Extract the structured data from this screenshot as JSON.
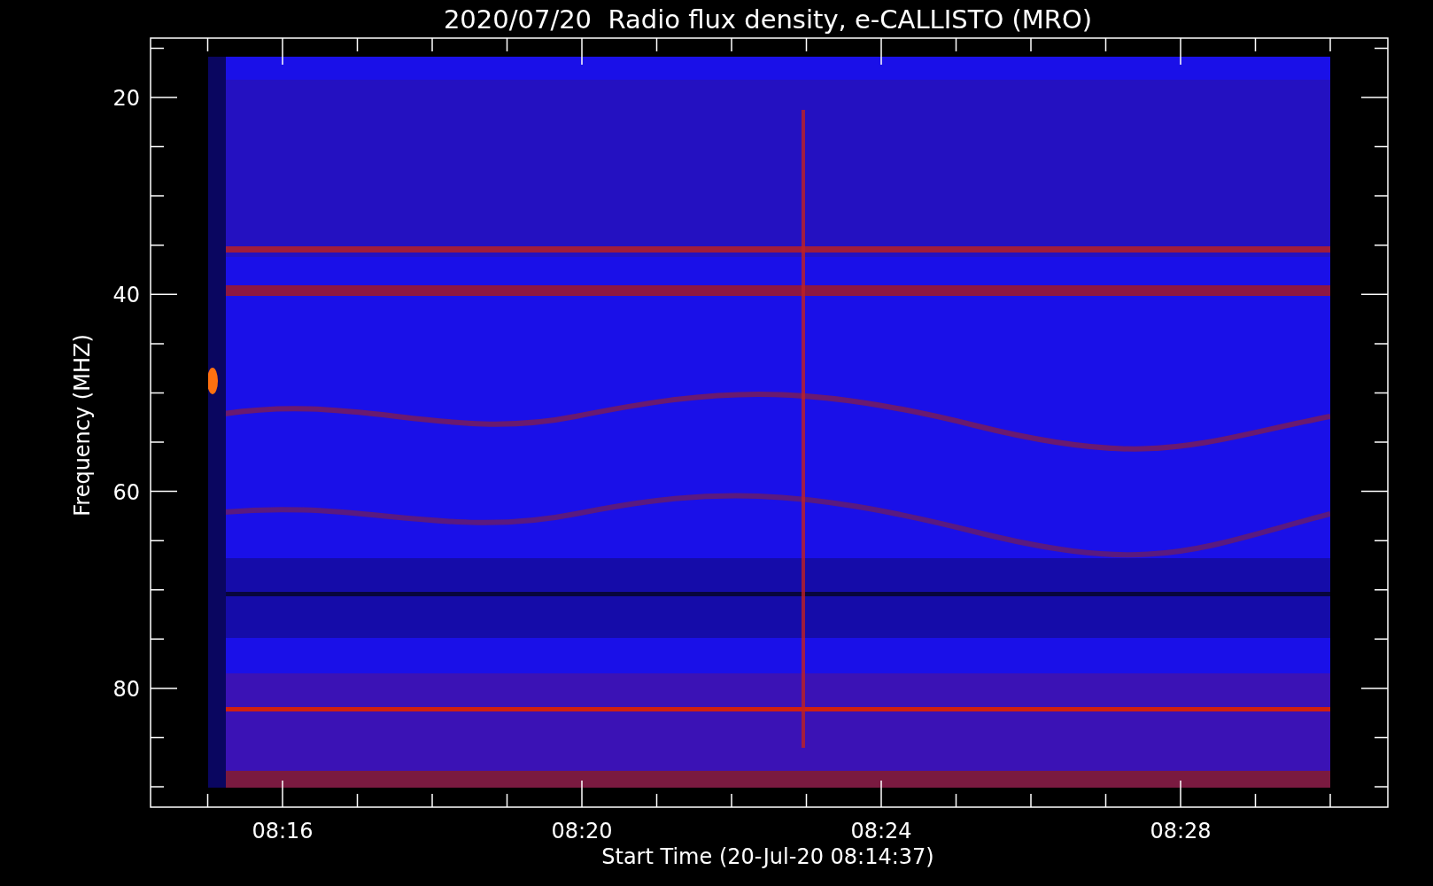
{
  "title": "2020/07/20  Radio flux density, e-CALLISTO (MRO)",
  "y_axis": {
    "title": "Frequency (MHZ)",
    "tick_labels": [
      "20",
      "40",
      "60",
      "80"
    ]
  },
  "x_axis": {
    "title": "Start Time (20-Jul-20 08:14:37)",
    "tick_labels": [
      "08:16",
      "08:20",
      "08:24",
      "08:28"
    ]
  }
}
